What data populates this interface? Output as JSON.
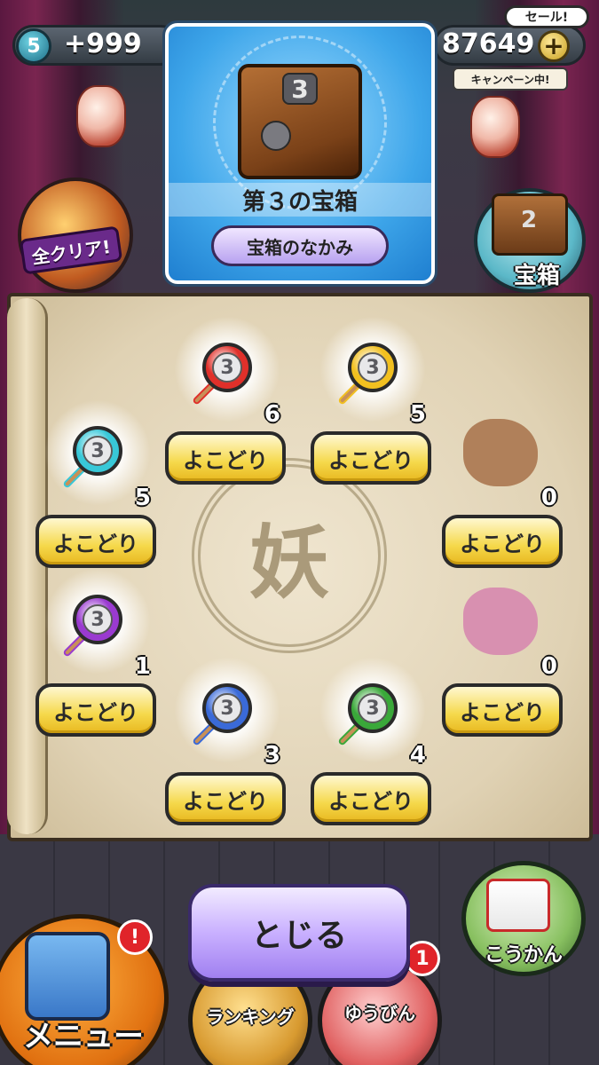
{
  "hud": {
    "key_level": "5",
    "left_value": "+999",
    "right_value": "87649",
    "plus_label": "+",
    "sale_label": "セール!",
    "campaign_label": "キャンペーン中!"
  },
  "left_badge": {
    "label": "全クリア!"
  },
  "chest_button": {
    "label": "宝箱",
    "chest_number": "2"
  },
  "info_card": {
    "chest_number": "3",
    "title": "第３の宝箱",
    "contents_button": "宝箱のなかみ"
  },
  "emblem": {
    "glyph": "妖"
  },
  "items": [
    {
      "color": "red",
      "medal_num": "3",
      "count": "6",
      "button": "よこどり",
      "revealed": true
    },
    {
      "color": "yellow",
      "medal_num": "3",
      "count": "5",
      "button": "よこどり",
      "revealed": true
    },
    {
      "color": "cyan",
      "medal_num": "3",
      "count": "5",
      "button": "よこどり",
      "revealed": true
    },
    {
      "color": "brown",
      "medal_num": "",
      "count": "0",
      "button": "よこどり",
      "revealed": false
    },
    {
      "color": "purple",
      "medal_num": "3",
      "count": "1",
      "button": "よこどり",
      "revealed": true
    },
    {
      "color": "pink",
      "medal_num": "",
      "count": "0",
      "button": "よこどり",
      "revealed": false
    },
    {
      "color": "blue",
      "medal_num": "3",
      "count": "3",
      "button": "よこどり",
      "revealed": true
    },
    {
      "color": "green",
      "medal_num": "3",
      "count": "4",
      "button": "よこどり",
      "revealed": true
    }
  ],
  "colors": {
    "red": "#e0302a",
    "yellow": "#f2c020",
    "cyan": "#38c8d8",
    "brown": "#b0805a",
    "purple": "#9a3ad0",
    "pink": "#d890b0",
    "blue": "#3a6ad8",
    "green": "#3aa83a"
  },
  "bottom": {
    "close_button": "とじる",
    "menu_label": "メニュー",
    "menu_alert": "!",
    "ranking_label": "ランキング",
    "mail_label": "ゆうびん",
    "mail_alert": "1",
    "exchange_label": "こうかん"
  }
}
